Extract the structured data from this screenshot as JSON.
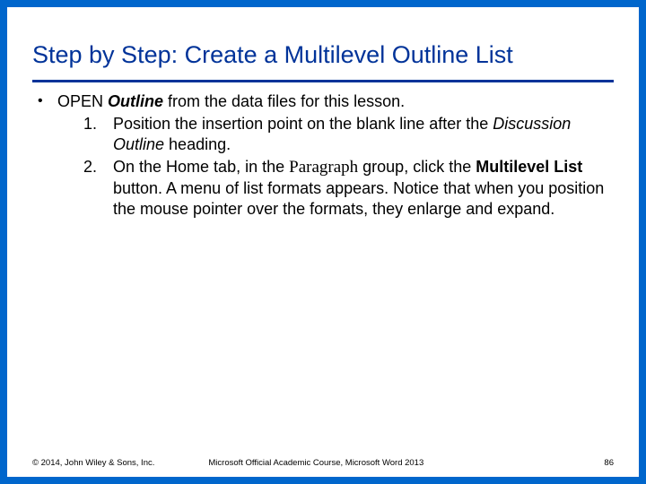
{
  "title": "Step by Step: Create a Multilevel Outline List",
  "bullet": {
    "prefix": "OPEN ",
    "file": "Outline",
    "suffix": " from the data files for this lesson."
  },
  "steps": [
    {
      "num": "1.",
      "part1": "Position the insertion point on the blank line after the ",
      "em1": "Discussion Outline",
      "part2": " heading."
    },
    {
      "num": "2.",
      "part1": "On the Home tab, in the ",
      "serif1": "Paragraph",
      "part2": " group, click the ",
      "bold1": "Multilevel List",
      "part3": " button. A menu of list formats appears. Notice that when you position the mouse pointer over the formats, they enlarge and expand."
    }
  ],
  "footer": {
    "left": "© 2014, John Wiley & Sons, Inc.",
    "center": "Microsoft Official Academic Course, Microsoft Word 2013",
    "page": "86"
  }
}
